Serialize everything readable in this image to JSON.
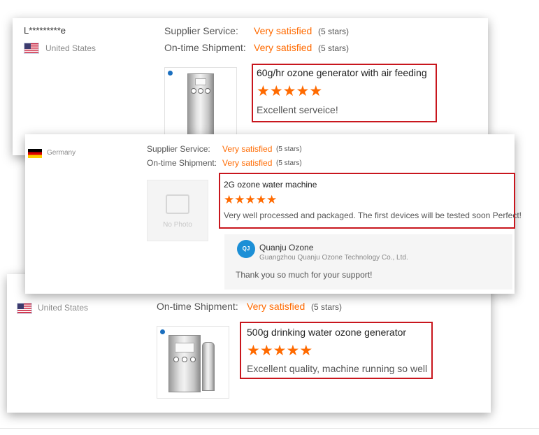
{
  "review1": {
    "user": "L*********e",
    "country": "United States",
    "service_label": "Supplier Service:",
    "service_value": "Very satisfied",
    "service_stars": "(5 stars)",
    "shipment_label": "On-time Shipment:",
    "shipment_value": "Very satisfied",
    "shipment_stars": "(5 stars)",
    "product_title": "60g/hr ozone generator with air feeding",
    "rating": 5,
    "comment": "Excellent serveice!"
  },
  "review2": {
    "country": "Germany",
    "service_label": "Supplier Service:",
    "service_value": "Very satisfied",
    "service_stars": "(5 stars)",
    "shipment_label": "On-time Shipment:",
    "shipment_value": "Very satisfied",
    "shipment_stars": "(5 stars)",
    "no_photo": "No Photo",
    "product_title": "2G ozone water machine",
    "rating": 5,
    "comment": "Very well processed and packaged. The first devices will be tested soon Perfect!",
    "reply": {
      "name": "Quanju Ozone",
      "company": "Guangzhou Quanju Ozone Technology Co., Ltd.",
      "message": "Thank you so much for your support!"
    }
  },
  "review3": {
    "country": "United States",
    "shipment_label": "On-time Shipment:",
    "shipment_value": "Very satisfied",
    "shipment_stars": "(5 stars)",
    "product_title": "500g drinking water ozone generator",
    "rating": 5,
    "comment": "Excellent quality, machine running so well"
  },
  "colors": {
    "accent": "#ff6a00",
    "highlight_border": "#c8161d"
  },
  "icons": {
    "star": "star-icon",
    "flag_us": "us-flag-icon",
    "flag_de": "germany-flag-icon"
  }
}
